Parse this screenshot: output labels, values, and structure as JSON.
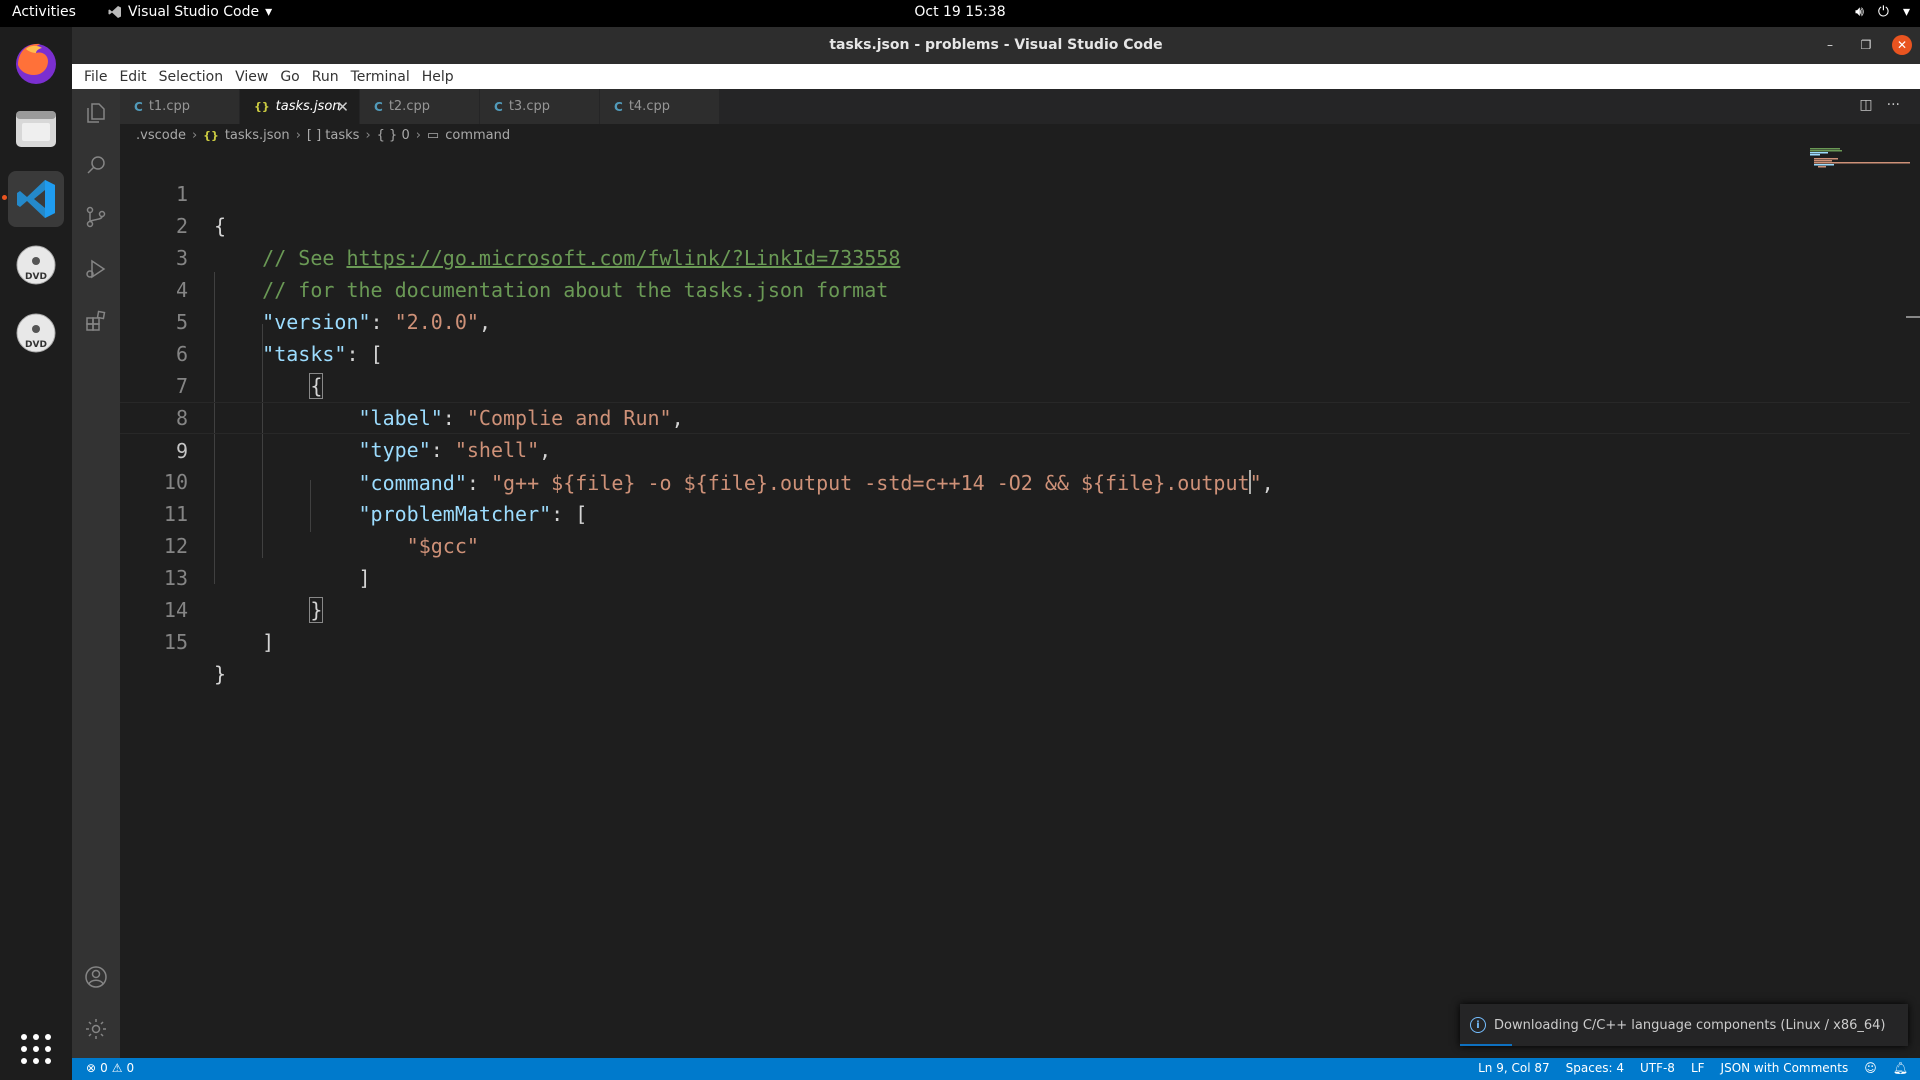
{
  "topbar": {
    "activities": "Activities",
    "app_name": "Visual Studio Code",
    "clock": "Oct 19  15:38"
  },
  "window": {
    "title": "tasks.json - problems - Visual Studio Code"
  },
  "menu": [
    "File",
    "Edit",
    "Selection",
    "View",
    "Go",
    "Run",
    "Terminal",
    "Help"
  ],
  "tabs": [
    {
      "label": "t1.cpp",
      "icon": "cpp-file-icon",
      "active": false
    },
    {
      "label": "tasks.json",
      "icon": "json-file-icon",
      "active": true
    },
    {
      "label": "t2.cpp",
      "icon": "cpp-file-icon",
      "active": false
    },
    {
      "label": "t3.cpp",
      "icon": "cpp-file-icon",
      "active": false
    },
    {
      "label": "t4.cpp",
      "icon": "cpp-file-icon",
      "active": false
    }
  ],
  "breadcrumb": {
    "folder": ".vscode",
    "file": "tasks.json",
    "tasks": "[ ] tasks",
    "index": "{ } 0",
    "command": "command"
  },
  "editor": {
    "line_numbers": [
      "1",
      "2",
      "3",
      "4",
      "5",
      "6",
      "7",
      "8",
      "9",
      "10",
      "11",
      "12",
      "13",
      "14",
      "15"
    ],
    "current_line": 9,
    "code": {
      "l2_comment": "// See ",
      "l2_link": "https://go.microsoft.com/fwlink/?LinkId=733558",
      "l3_comment": "// for the documentation about the tasks.json format",
      "version_key": "\"version\"",
      "version_val": "\"2.0.0\"",
      "tasks_key": "\"tasks\"",
      "label_key": "\"label\"",
      "label_val": "\"Complie and Run\"",
      "type_key": "\"type\"",
      "type_val": "\"shell\"",
      "command_key": "\"command\"",
      "command_val_a": "\"g++ ${file} -o ${file}.output -std=c++14 -O2 && ${file}.output",
      "command_val_b": "\"",
      "matcher_key": "\"problemMatcher\"",
      "matcher_val": "\"$gcc\""
    }
  },
  "notification": {
    "text": "Downloading C/C++ language components (Linux / x86_64)"
  },
  "statusbar": {
    "errors": "0",
    "warnings": "0",
    "position": "Ln 9, Col 87",
    "spaces": "Spaces: 4",
    "encoding": "UTF-8",
    "eol": "LF",
    "language": "JSON with Comments"
  },
  "colors": {
    "accent": "#007acc",
    "ubuntu_orange": "#e95420"
  }
}
